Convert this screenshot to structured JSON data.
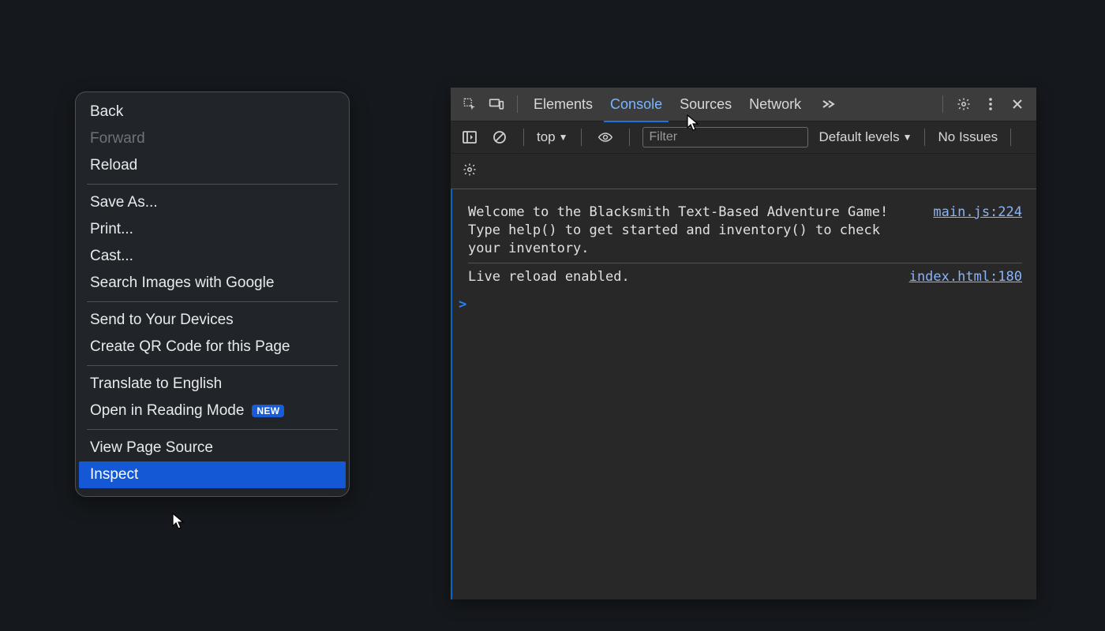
{
  "context_menu": {
    "items": [
      {
        "label": "Back"
      },
      {
        "label": "Forward",
        "disabled": true
      },
      {
        "label": "Reload"
      }
    ],
    "items2": [
      {
        "label": "Save As..."
      },
      {
        "label": "Print..."
      },
      {
        "label": "Cast..."
      },
      {
        "label": "Search Images with Google"
      }
    ],
    "items3": [
      {
        "label": "Send to Your Devices"
      },
      {
        "label": "Create QR Code for this Page"
      }
    ],
    "items4": [
      {
        "label": "Translate to English"
      },
      {
        "label": "Open in Reading Mode",
        "badge": "NEW"
      }
    ],
    "items5": [
      {
        "label": "View Page Source"
      },
      {
        "label": "Inspect",
        "highlight": true
      }
    ]
  },
  "devtools": {
    "tabs": [
      "Elements",
      "Console",
      "Sources",
      "Network"
    ],
    "active_tab": "Console",
    "toolbar": {
      "context_label": "top",
      "filter_placeholder": "Filter",
      "levels_label": "Default levels",
      "issues_label": "No Issues"
    },
    "console": {
      "rows": [
        {
          "text": "Welcome to the Blacksmith Text-Based Adventure Game! Type help() to get started and inventory() to check your inventory.",
          "src": "main.js:224"
        },
        {
          "text": "Live reload enabled.",
          "src": "index.html:180"
        }
      ],
      "prompt_symbol": ">"
    }
  }
}
